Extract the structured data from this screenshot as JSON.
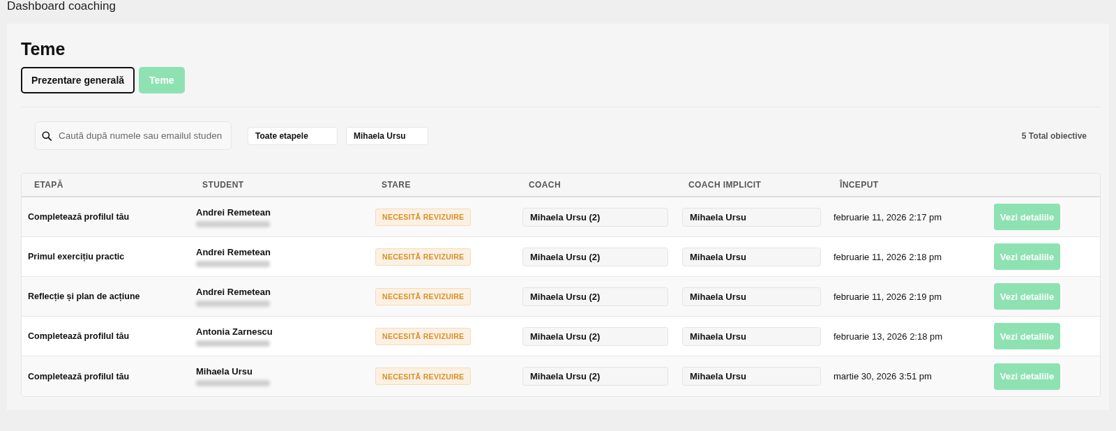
{
  "page": {
    "title": "Dashboard coaching"
  },
  "section": {
    "heading": "Teme"
  },
  "tabs": [
    {
      "label": "Prezentare generală",
      "selected": false
    },
    {
      "label": "Teme",
      "selected": true
    }
  ],
  "filters": {
    "search": {
      "placeholder": "Caută după numele sau emailul studen"
    },
    "stage": "Toate etapele",
    "coach": "Mihaela Ursu",
    "total": "5 Total obiective"
  },
  "table": {
    "columns": [
      "ETAPĂ",
      "STUDENT",
      "STARE",
      "COACH",
      "COACH IMPLICIT",
      "ÎNCEPUT"
    ],
    "rows": [
      {
        "stage": "Completează profilul tău",
        "student": {
          "name": "Andrei Remetean",
          "email_blurred": true
        },
        "status": {
          "label": "NECESITĂ REVIZUIRE",
          "kind": "review"
        },
        "coach": "Mihaela Ursu (2)",
        "default_coach": "Mihaela Ursu",
        "started": "februarie 11, 2026 2:17 pm",
        "action": "Vezi detaliile"
      },
      {
        "stage": "Primul exercițiu practic",
        "student": {
          "name": "Andrei Remetean",
          "email_blurred": true
        },
        "status": {
          "label": "NECESITĂ REVIZUIRE",
          "kind": "review"
        },
        "coach": "Mihaela Ursu (2)",
        "default_coach": "Mihaela Ursu",
        "started": "februarie 11, 2026 2:18 pm",
        "action": "Vezi detaliile"
      },
      {
        "stage": "Reflecție și plan de acțiune",
        "student": {
          "name": "Andrei Remetean",
          "email_blurred": true
        },
        "status": {
          "label": "NECESITĂ REVIZUIRE",
          "kind": "review"
        },
        "coach": "Mihaela Ursu (2)",
        "default_coach": "Mihaela Ursu",
        "started": "februarie 11, 2026 2:19 pm",
        "action": "Vezi detaliile"
      },
      {
        "stage": "Completează profilul tău",
        "student": {
          "name": "Antonia Zarnescu",
          "email_blurred": true
        },
        "status": {
          "label": "NECESITĂ REVIZUIRE",
          "kind": "review"
        },
        "coach": "Mihaela Ursu (2)",
        "default_coach": "Mihaela Ursu",
        "started": "februarie 13, 2026 2:18 pm",
        "action": "Vezi detaliile"
      },
      {
        "stage": "Completează profilul tău",
        "student": {
          "name": "Mihaela Ursu",
          "email_blurred": true
        },
        "status": {
          "label": "NECESITĂ REVIZUIRE",
          "kind": "review"
        },
        "coach": "Mihaela Ursu (2)",
        "default_coach": "Mihaela Ursu",
        "started": "martie 30, 2026 3:51 pm",
        "action": "Vezi detaliile"
      }
    ]
  }
}
